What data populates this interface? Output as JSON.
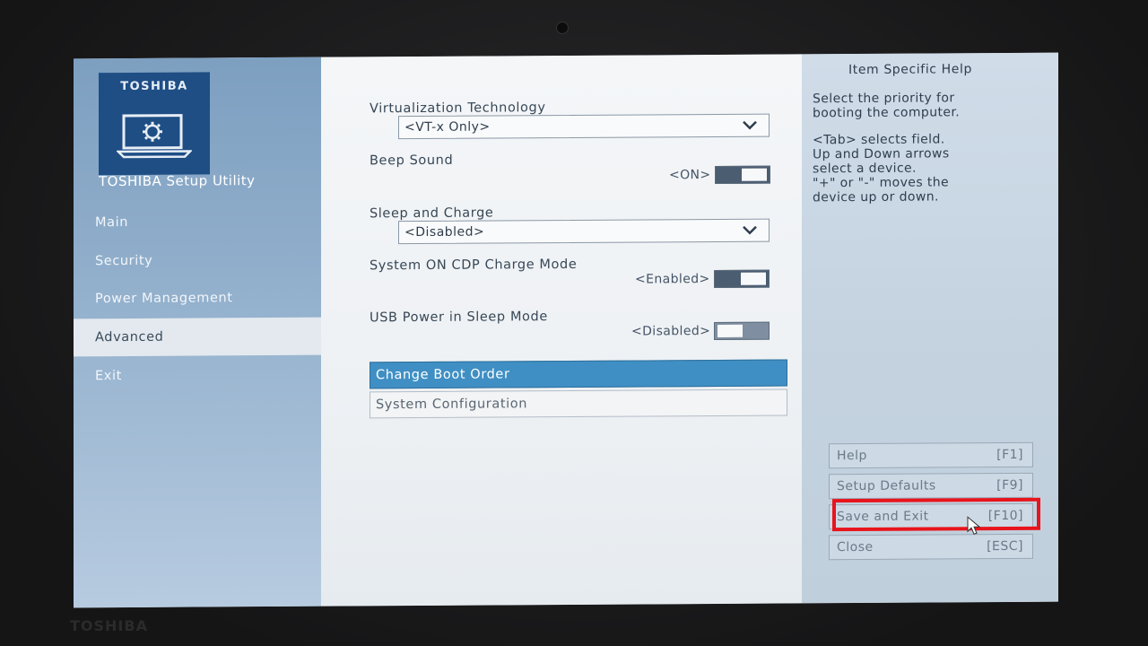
{
  "bezel": {
    "brand": "TOSHIBA"
  },
  "sidebar": {
    "logo_text": "TOSHIBA",
    "app_title": "TOSHIBA Setup Utility",
    "items": [
      {
        "label": "Main"
      },
      {
        "label": "Security"
      },
      {
        "label": "Power Management"
      },
      {
        "label": "Advanced",
        "selected": true
      },
      {
        "label": "Exit"
      }
    ]
  },
  "settings": {
    "virtualization": {
      "label": "Virtualization Technology",
      "value": "<VT-x Only>"
    },
    "beep": {
      "label": "Beep Sound",
      "value": "<ON>",
      "state": "on"
    },
    "sleep_charge": {
      "label": "Sleep and Charge",
      "value": "<Disabled>"
    },
    "cdp": {
      "label": "System ON CDP Charge Mode",
      "value": "<Enabled>",
      "state": "on"
    },
    "usb_power": {
      "label": "USB Power in Sleep Mode",
      "value": "<Disabled>",
      "state": "off"
    }
  },
  "submenus": [
    {
      "label": "Change Boot Order",
      "active": true
    },
    {
      "label": "System Configuration",
      "active": false
    }
  ],
  "help": {
    "title": "Item Specific Help",
    "description": "Select the priority for\nbooting the computer.",
    "instructions": "<Tab> selects field.\nUp and Down arrows\nselect a device.\n\"+\" or \"-\" moves the\ndevice up or down."
  },
  "keys": [
    {
      "label": "Help",
      "key": "[F1]"
    },
    {
      "label": "Setup Defaults",
      "key": "[F9]"
    },
    {
      "label": "Save and Exit",
      "key": "[F10]",
      "highlighted": true
    },
    {
      "label": "Close",
      "key": "[ESC]"
    }
  ],
  "colors": {
    "accent": "#3f8fc4",
    "highlight": "#e8141c",
    "logo_bg": "#1f4e85"
  }
}
